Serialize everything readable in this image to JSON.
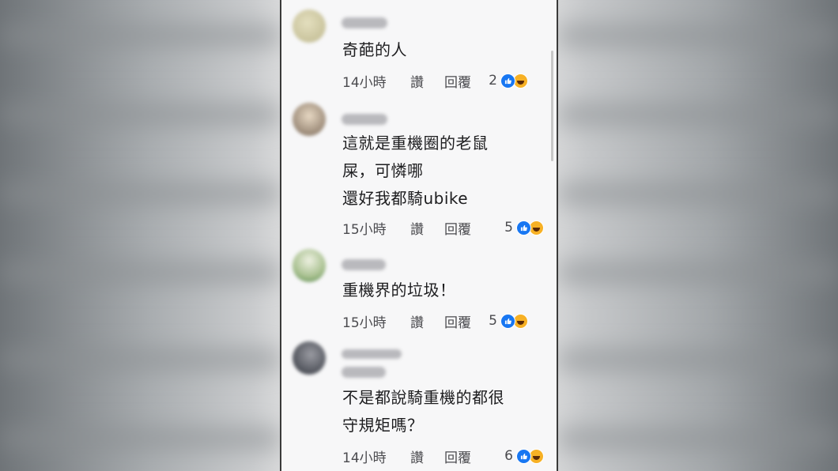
{
  "comments": [
    {
      "text": "奇葩的人",
      "time": "14小時",
      "like": "讚",
      "reply": "回覆",
      "reactions": "2",
      "avatar_color": "#c9c49d"
    },
    {
      "text": "這就是重機圈的老鼠\n屎，可憐哪\n還好我都騎ubike",
      "time": "15小時",
      "like": "讚",
      "reply": "回覆",
      "reactions": "5",
      "avatar_color": "#b7a58f"
    },
    {
      "text": "重機界的垃圾！",
      "time": "15小時",
      "like": "讚",
      "reply": "回覆",
      "reactions": "5",
      "avatar_color": "#9bb28a"
    },
    {
      "text": "不是都說騎重機的都很\n守規矩嗎？",
      "time": "14小時",
      "like": "讚",
      "reply": "回覆",
      "reactions": "6",
      "avatar_color": "#5b5e66"
    }
  ],
  "icons": {
    "like_reaction": "thumbs-up-icon",
    "haha_reaction": "laughing-face-icon"
  }
}
